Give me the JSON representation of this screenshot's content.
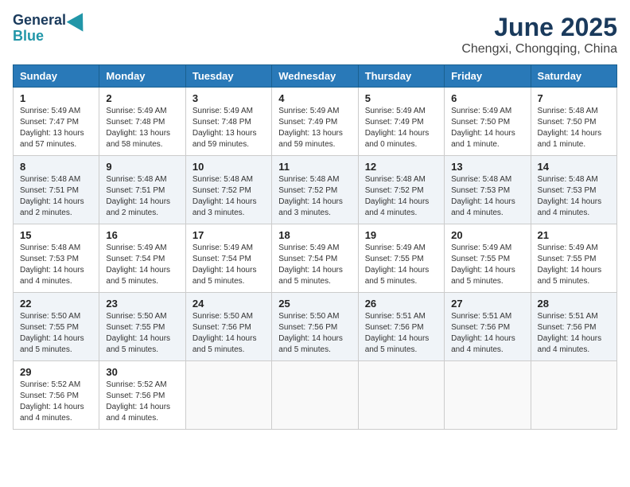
{
  "header": {
    "logo_line1": "General",
    "logo_line2": "Blue",
    "title": "June 2025",
    "subtitle": "Chengxi, Chongqing, China"
  },
  "calendar": {
    "days_of_week": [
      "Sunday",
      "Monday",
      "Tuesday",
      "Wednesday",
      "Thursday",
      "Friday",
      "Saturday"
    ],
    "weeks": [
      [
        {
          "day": "1",
          "info": "Sunrise: 5:49 AM\nSunset: 7:47 PM\nDaylight: 13 hours\nand 57 minutes."
        },
        {
          "day": "2",
          "info": "Sunrise: 5:49 AM\nSunset: 7:48 PM\nDaylight: 13 hours\nand 58 minutes."
        },
        {
          "day": "3",
          "info": "Sunrise: 5:49 AM\nSunset: 7:48 PM\nDaylight: 13 hours\nand 59 minutes."
        },
        {
          "day": "4",
          "info": "Sunrise: 5:49 AM\nSunset: 7:49 PM\nDaylight: 13 hours\nand 59 minutes."
        },
        {
          "day": "5",
          "info": "Sunrise: 5:49 AM\nSunset: 7:49 PM\nDaylight: 14 hours\nand 0 minutes."
        },
        {
          "day": "6",
          "info": "Sunrise: 5:49 AM\nSunset: 7:50 PM\nDaylight: 14 hours\nand 1 minute."
        },
        {
          "day": "7",
          "info": "Sunrise: 5:48 AM\nSunset: 7:50 PM\nDaylight: 14 hours\nand 1 minute."
        }
      ],
      [
        {
          "day": "8",
          "info": "Sunrise: 5:48 AM\nSunset: 7:51 PM\nDaylight: 14 hours\nand 2 minutes."
        },
        {
          "day": "9",
          "info": "Sunrise: 5:48 AM\nSunset: 7:51 PM\nDaylight: 14 hours\nand 2 minutes."
        },
        {
          "day": "10",
          "info": "Sunrise: 5:48 AM\nSunset: 7:52 PM\nDaylight: 14 hours\nand 3 minutes."
        },
        {
          "day": "11",
          "info": "Sunrise: 5:48 AM\nSunset: 7:52 PM\nDaylight: 14 hours\nand 3 minutes."
        },
        {
          "day": "12",
          "info": "Sunrise: 5:48 AM\nSunset: 7:52 PM\nDaylight: 14 hours\nand 4 minutes."
        },
        {
          "day": "13",
          "info": "Sunrise: 5:48 AM\nSunset: 7:53 PM\nDaylight: 14 hours\nand 4 minutes."
        },
        {
          "day": "14",
          "info": "Sunrise: 5:48 AM\nSunset: 7:53 PM\nDaylight: 14 hours\nand 4 minutes."
        }
      ],
      [
        {
          "day": "15",
          "info": "Sunrise: 5:48 AM\nSunset: 7:53 PM\nDaylight: 14 hours\nand 4 minutes."
        },
        {
          "day": "16",
          "info": "Sunrise: 5:49 AM\nSunset: 7:54 PM\nDaylight: 14 hours\nand 5 minutes."
        },
        {
          "day": "17",
          "info": "Sunrise: 5:49 AM\nSunset: 7:54 PM\nDaylight: 14 hours\nand 5 minutes."
        },
        {
          "day": "18",
          "info": "Sunrise: 5:49 AM\nSunset: 7:54 PM\nDaylight: 14 hours\nand 5 minutes."
        },
        {
          "day": "19",
          "info": "Sunrise: 5:49 AM\nSunset: 7:55 PM\nDaylight: 14 hours\nand 5 minutes."
        },
        {
          "day": "20",
          "info": "Sunrise: 5:49 AM\nSunset: 7:55 PM\nDaylight: 14 hours\nand 5 minutes."
        },
        {
          "day": "21",
          "info": "Sunrise: 5:49 AM\nSunset: 7:55 PM\nDaylight: 14 hours\nand 5 minutes."
        }
      ],
      [
        {
          "day": "22",
          "info": "Sunrise: 5:50 AM\nSunset: 7:55 PM\nDaylight: 14 hours\nand 5 minutes."
        },
        {
          "day": "23",
          "info": "Sunrise: 5:50 AM\nSunset: 7:55 PM\nDaylight: 14 hours\nand 5 minutes."
        },
        {
          "day": "24",
          "info": "Sunrise: 5:50 AM\nSunset: 7:56 PM\nDaylight: 14 hours\nand 5 minutes."
        },
        {
          "day": "25",
          "info": "Sunrise: 5:50 AM\nSunset: 7:56 PM\nDaylight: 14 hours\nand 5 minutes."
        },
        {
          "day": "26",
          "info": "Sunrise: 5:51 AM\nSunset: 7:56 PM\nDaylight: 14 hours\nand 5 minutes."
        },
        {
          "day": "27",
          "info": "Sunrise: 5:51 AM\nSunset: 7:56 PM\nDaylight: 14 hours\nand 4 minutes."
        },
        {
          "day": "28",
          "info": "Sunrise: 5:51 AM\nSunset: 7:56 PM\nDaylight: 14 hours\nand 4 minutes."
        }
      ],
      [
        {
          "day": "29",
          "info": "Sunrise: 5:52 AM\nSunset: 7:56 PM\nDaylight: 14 hours\nand 4 minutes."
        },
        {
          "day": "30",
          "info": "Sunrise: 5:52 AM\nSunset: 7:56 PM\nDaylight: 14 hours\nand 4 minutes."
        },
        {
          "day": "",
          "info": ""
        },
        {
          "day": "",
          "info": ""
        },
        {
          "day": "",
          "info": ""
        },
        {
          "day": "",
          "info": ""
        },
        {
          "day": "",
          "info": ""
        }
      ]
    ]
  }
}
